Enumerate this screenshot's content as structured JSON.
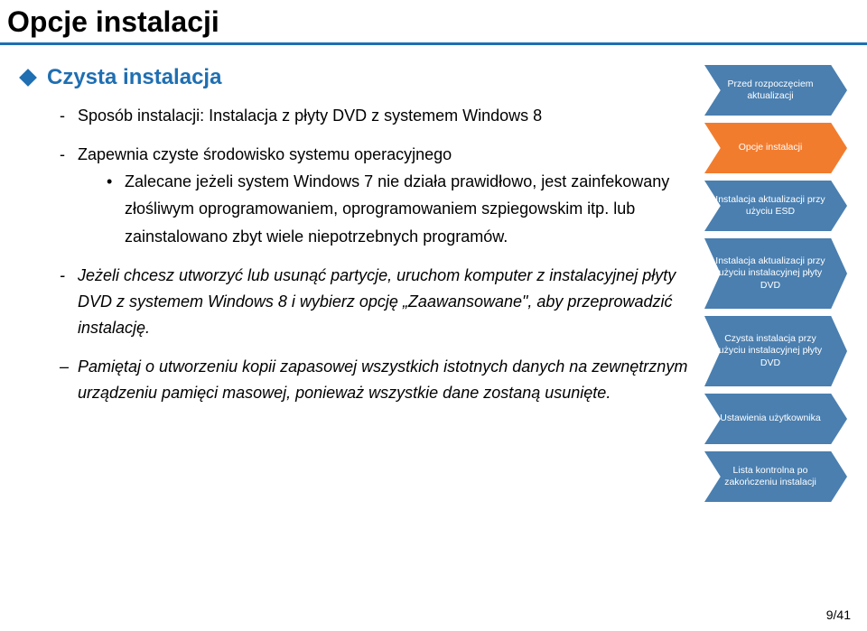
{
  "title": "Opcje instalacji",
  "heading": "Czysta instalacja",
  "bullets": {
    "b1": "Sposób instalacji: Instalacja z płyty DVD z systemem Windows 8",
    "b2": "Zapewnia czyste środowisko systemu operacyjnego",
    "b2s1": "Zalecane jeżeli system Windows 7 nie działa prawidłowo, jest zainfekowany złośliwym oprogramowaniem, oprogramowaniem szpiegowskim itp. lub zainstalowano zbyt wiele niepotrzebnych programów.",
    "b3": "Jeżeli chcesz utworzyć lub usunąć partycje, uruchom komputer z instalacyjnej płyty DVD z systemem Windows 8 i wybierz opcję „Zaawansowane\", aby przeprowadzić instalację.",
    "b4": "Pamiętaj o utworzeniu kopii zapasowej wszystkich istotnych danych na zewnętrznym urządzeniu pamięci masowej, ponieważ wszystkie dane zostaną usunięte."
  },
  "steps": {
    "s1": "Przed rozpoczęciem aktualizacji",
    "s2": "Opcje instalacji",
    "s3": "Instalacja aktualizacji przy użyciu ESD",
    "s4": "Instalacja aktualizacji przy użyciu instalacyjnej płyty DVD",
    "s5": "Czysta instalacja przy użyciu instalacyjnej płyty DVD",
    "s6": "Ustawienia użytkownika",
    "s7": "Lista kontrolna po zakończeniu instalacji"
  },
  "colors": {
    "inactive": "#4A7FB0",
    "active": "#F27C2E"
  },
  "page_number": "9/41"
}
